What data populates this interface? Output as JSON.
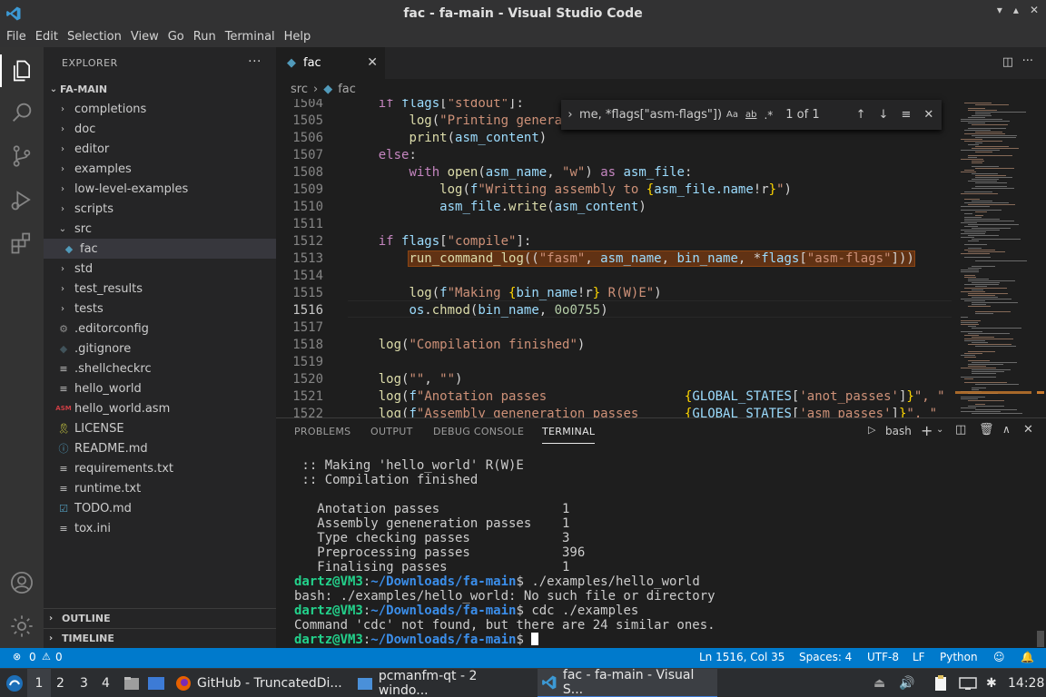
{
  "window": {
    "title": "fac - fa-main - Visual Studio Code"
  },
  "menu": [
    "File",
    "Edit",
    "Selection",
    "View",
    "Go",
    "Run",
    "Terminal",
    "Help"
  ],
  "sidebar": {
    "header": "EXPLORER",
    "root": "FA-MAIN",
    "items": [
      {
        "label": "completions",
        "kind": "folder"
      },
      {
        "label": "doc",
        "kind": "folder"
      },
      {
        "label": "editor",
        "kind": "folder"
      },
      {
        "label": "examples",
        "kind": "folder"
      },
      {
        "label": "low-level-examples",
        "kind": "folder"
      },
      {
        "label": "scripts",
        "kind": "folder"
      },
      {
        "label": "src",
        "kind": "folder-open"
      },
      {
        "label": "fac",
        "kind": "file-python",
        "selected": true
      },
      {
        "label": "std",
        "kind": "folder"
      },
      {
        "label": "test_results",
        "kind": "folder"
      },
      {
        "label": "tests",
        "kind": "folder"
      },
      {
        "label": ".editorconfig",
        "kind": "file-gear"
      },
      {
        "label": ".gitignore",
        "kind": "file-git"
      },
      {
        "label": ".shellcheckrc",
        "kind": "file-text"
      },
      {
        "label": "hello_world",
        "kind": "file-text"
      },
      {
        "label": "hello_world.asm",
        "kind": "file-asm"
      },
      {
        "label": "LICENSE",
        "kind": "file-license"
      },
      {
        "label": "README.md",
        "kind": "file-info"
      },
      {
        "label": "requirements.txt",
        "kind": "file-text"
      },
      {
        "label": "runtime.txt",
        "kind": "file-text"
      },
      {
        "label": "TODO.md",
        "kind": "file-check"
      },
      {
        "label": "tox.ini",
        "kind": "file-text"
      }
    ],
    "outline": "OUTLINE",
    "timeline": "TIMELINE"
  },
  "tab": {
    "label": "fac"
  },
  "breadcrumb": {
    "folder": "src",
    "file": "fac"
  },
  "find": {
    "query": "me, *flags[\"asm-flags\"])",
    "match_case": "Aa",
    "whole_word": "ab",
    "regex": ".*",
    "result": "1 of 1"
  },
  "editor": {
    "line_numbers": [
      "1504",
      "1505",
      "1506",
      "1507",
      "1508",
      "1509",
      "1510",
      "1511",
      "1512",
      "1513",
      "1514",
      "1515",
      "1516",
      "1517",
      "1518",
      "1519",
      "1520",
      "1521",
      "1522"
    ],
    "current_line": "1516"
  },
  "panel": {
    "tabs": [
      "PROBLEMS",
      "OUTPUT",
      "DEBUG CONSOLE",
      "TERMINAL"
    ],
    "active_tab": "TERMINAL",
    "shell": "bash",
    "terminal_lines": [
      " :: Making 'hello_world' R(W)E",
      " :: Compilation finished",
      "",
      "   Anotation passes                1",
      "   Assembly geneneration passes    1",
      "   Type checking passes            3",
      "   Preprocessing passes            396",
      "   Finalising passes               1"
    ],
    "prompt_user": "dartz@VM3",
    "prompt_path": "~/Downloads/fa-main",
    "cmd1": "./examples/hello_world",
    "out1": "bash: ./examples/hello_world: No such file or directory",
    "cmd2": "cdc ./examples",
    "out2": "Command 'cdc' not found, but there are 24 similar ones."
  },
  "status": {
    "errors": "0",
    "warnings": "0",
    "position": "Ln 1516, Col 35",
    "spaces": "Spaces: 4",
    "encoding": "UTF-8",
    "eol": "LF",
    "language": "Python"
  },
  "taskbar": {
    "workspaces": [
      "1",
      "2",
      "3",
      "4"
    ],
    "apps": [
      "GitHub - TruncatedDi...",
      "pcmanfm-qt - 2 windo...",
      "fac - fa-main - Visual S..."
    ],
    "clock": "14:28"
  },
  "colors": {
    "accent": "#007acc",
    "titlebar": "#323233",
    "sidebar": "#252526",
    "editor": "#1e1e1e"
  }
}
